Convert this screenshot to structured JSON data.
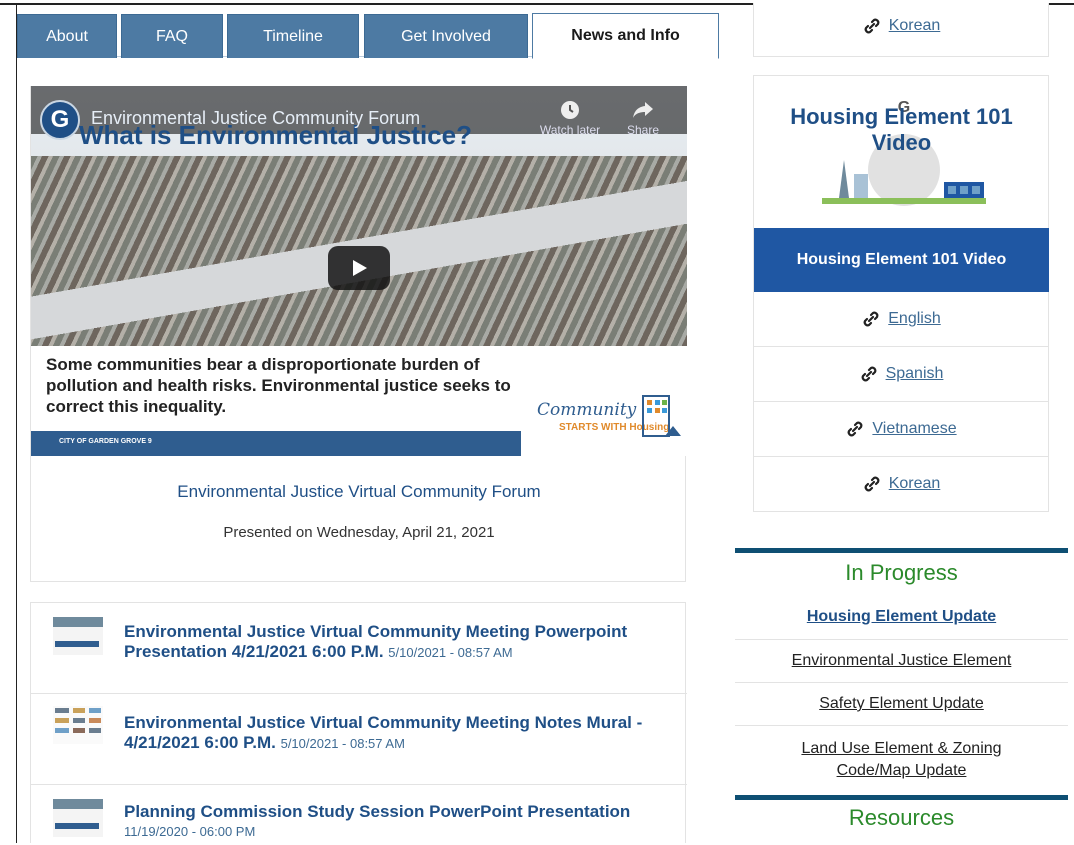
{
  "tabs": [
    {
      "label": "About"
    },
    {
      "label": "FAQ"
    },
    {
      "label": "Timeline"
    },
    {
      "label": "Get Involved"
    },
    {
      "label": "News and Info"
    }
  ],
  "video": {
    "overlay_title": "Environmental Justice Community Forum",
    "slide_title": "What is Environmental Justice?",
    "watch_later": "Watch later",
    "share": "Share",
    "caption": "Some communities bear a disproportionate burden of pollution and health risks. Environmental justice seeks to correct this inequality.",
    "city": "CITY OF GARDEN GROVE   9",
    "logo_text_1": "Community",
    "logo_text_2": "STARTS WITH Housing",
    "title": "Environmental Justice Virtual Community Forum",
    "subtitle": "Presented on Wednesday, April 21, 2021"
  },
  "documents": [
    {
      "title": "Environmental Justice Virtual Community Meeting Powerpoint Presentation 4/21/2021 6:00 P.M.",
      "date": "5/10/2021 - 08:57 AM"
    },
    {
      "title": "Environmental Justice Virtual Community Meeting Notes Mural - 4/21/2021 6:00 P.M.",
      "date": "5/10/2021 - 08:57 AM"
    },
    {
      "title": "Planning Commission Study Session PowerPoint Presentation",
      "date": "11/19/2020 - 06:00 PM"
    }
  ],
  "top_card": {
    "link": "Korean"
  },
  "housing_card": {
    "image_title": "Housing Element 101 Video",
    "banner": "Housing Element 101 Video",
    "links": [
      "English",
      "Spanish",
      "Vietnamese",
      "Korean"
    ]
  },
  "in_progress": {
    "title": "In Progress",
    "items": [
      "Housing Element Update",
      "Environmental Justice Element",
      "Safety Element Update",
      "Land Use Element & Zoning Code/Map Update"
    ]
  },
  "resources": {
    "title": "Resources"
  }
}
